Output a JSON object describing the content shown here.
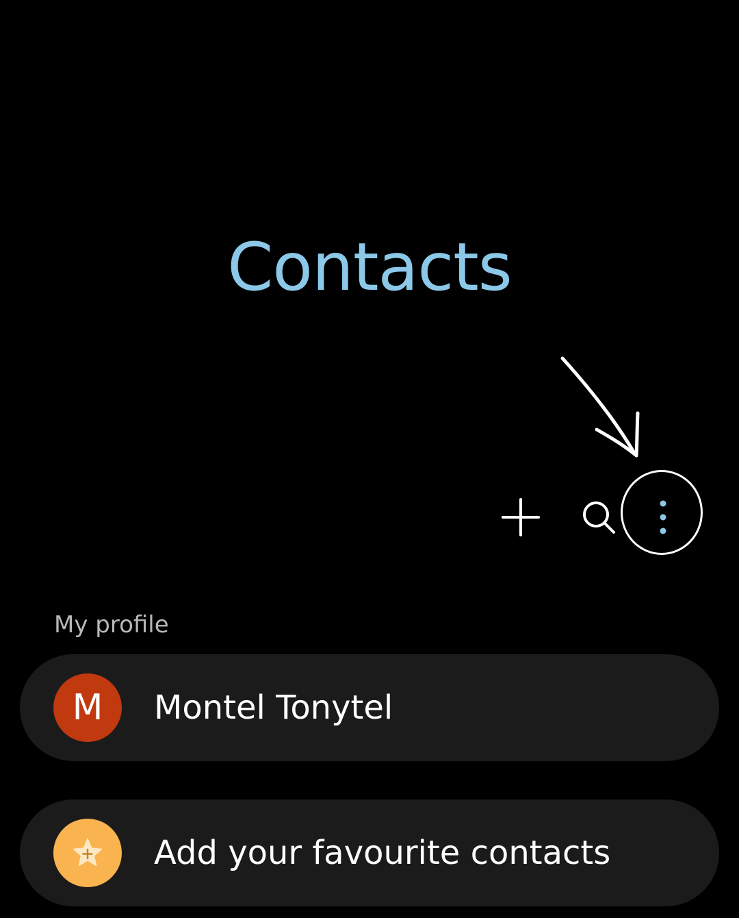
{
  "header": {
    "title": "Contacts"
  },
  "toolbar": {
    "add_icon": "plus-icon",
    "search_icon": "search-icon",
    "more_icon": "more-vertical-icon",
    "highlighted_item": "more-options-button"
  },
  "my_profile": {
    "section_label": "My profile",
    "name": "Montel Tonytel",
    "avatar_letter": "M"
  },
  "favourites": {
    "label": "Add your favourite contacts",
    "icon": "star-plus-icon"
  },
  "colors": {
    "background": "#000000",
    "title": "#8cc8e8",
    "card": "#1b1b1b",
    "profile_avatar": "#c0390f",
    "favourite_avatar": "#f9b34f",
    "more_dots": "#8cc8e8"
  }
}
